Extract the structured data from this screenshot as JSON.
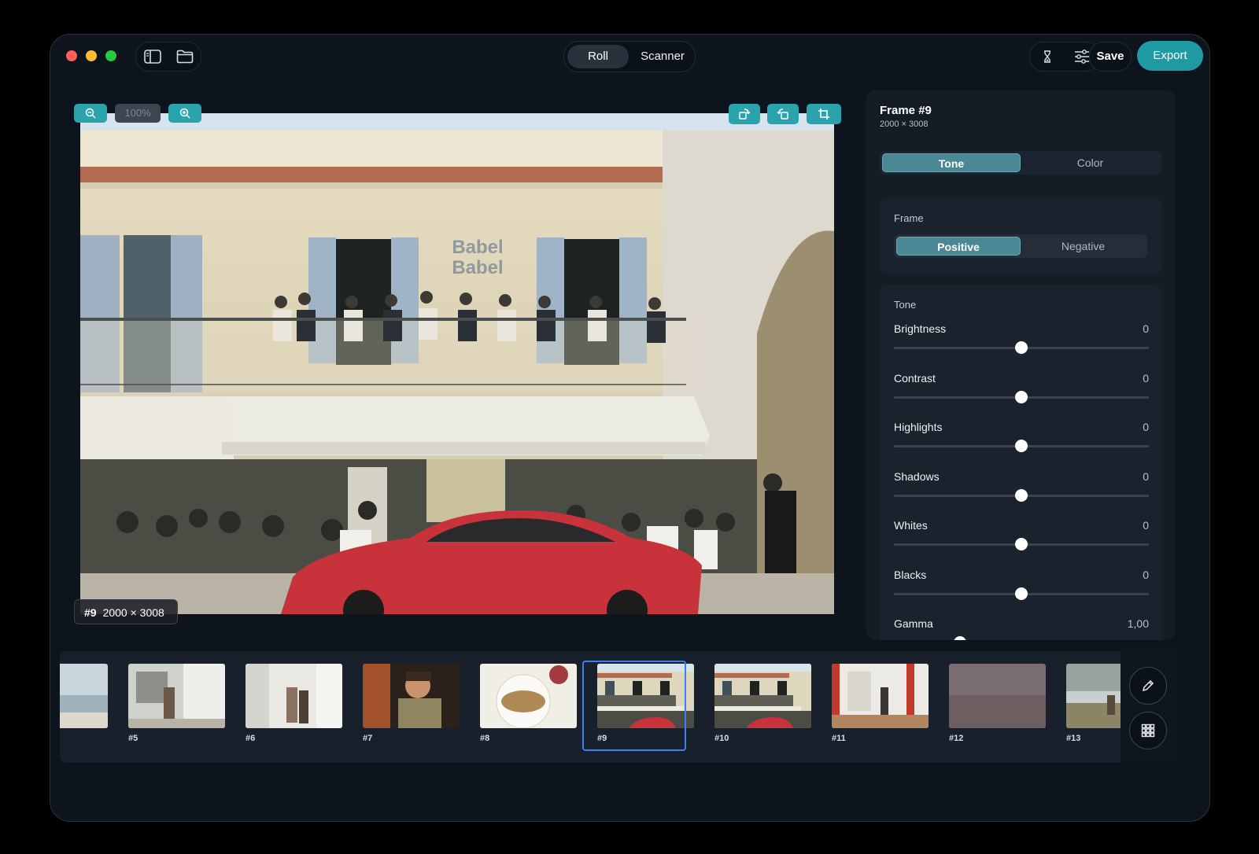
{
  "titlebar": {
    "mode_tabs": [
      {
        "label": "Roll",
        "active": true
      },
      {
        "label": "Scanner",
        "active": false
      }
    ],
    "save_label": "Save",
    "export_label": "Export",
    "icons": [
      "sidebar-icon",
      "folder-icon",
      "hourglass-icon",
      "sliders-icon"
    ]
  },
  "viewer": {
    "zoom_level": "100%",
    "frame_badge": {
      "number": "#9",
      "dimensions": "2000 × 3008"
    }
  },
  "panel": {
    "title": "Frame #9",
    "dimensions": "2000 × 3008",
    "tabs": [
      {
        "label": "Tone",
        "active": true
      },
      {
        "label": "Color",
        "active": false
      }
    ],
    "frame_section": {
      "label": "Frame",
      "options": [
        {
          "label": "Positive",
          "active": true
        },
        {
          "label": "Negative",
          "active": false
        }
      ]
    },
    "tone_section": {
      "label": "Tone",
      "sliders": [
        {
          "label": "Brightness",
          "value": "0",
          "position": 0.5
        },
        {
          "label": "Contrast",
          "value": "0",
          "position": 0.5
        },
        {
          "label": "Highlights",
          "value": "0",
          "position": 0.5
        },
        {
          "label": "Shadows",
          "value": "0",
          "position": 0.5
        },
        {
          "label": "Whites",
          "value": "0",
          "position": 0.5
        },
        {
          "label": "Blacks",
          "value": "0",
          "position": 0.5
        },
        {
          "label": "Gamma",
          "value": "1,00",
          "position": 0.26
        }
      ]
    }
  },
  "filmstrip": {
    "frames": [
      {
        "label": "",
        "scene": "sea"
      },
      {
        "label": "#5",
        "scene": "street"
      },
      {
        "label": "#6",
        "scene": "street-white"
      },
      {
        "label": "#7",
        "scene": "portrait"
      },
      {
        "label": "#8",
        "scene": "food"
      },
      {
        "label": "#9",
        "scene": "building",
        "selected": true
      },
      {
        "label": "#10",
        "scene": "building"
      },
      {
        "label": "#11",
        "scene": "interior"
      },
      {
        "label": "#12",
        "scene": "dusk"
      },
      {
        "label": "#13",
        "scene": "beach"
      }
    ],
    "tools": [
      "edit-icon",
      "grid-icon"
    ]
  },
  "colors": {
    "accent": "#1f9aa4",
    "selection": "#3d7ff0",
    "window_bg": "#0d141d",
    "panel_bg": "#141c26"
  }
}
